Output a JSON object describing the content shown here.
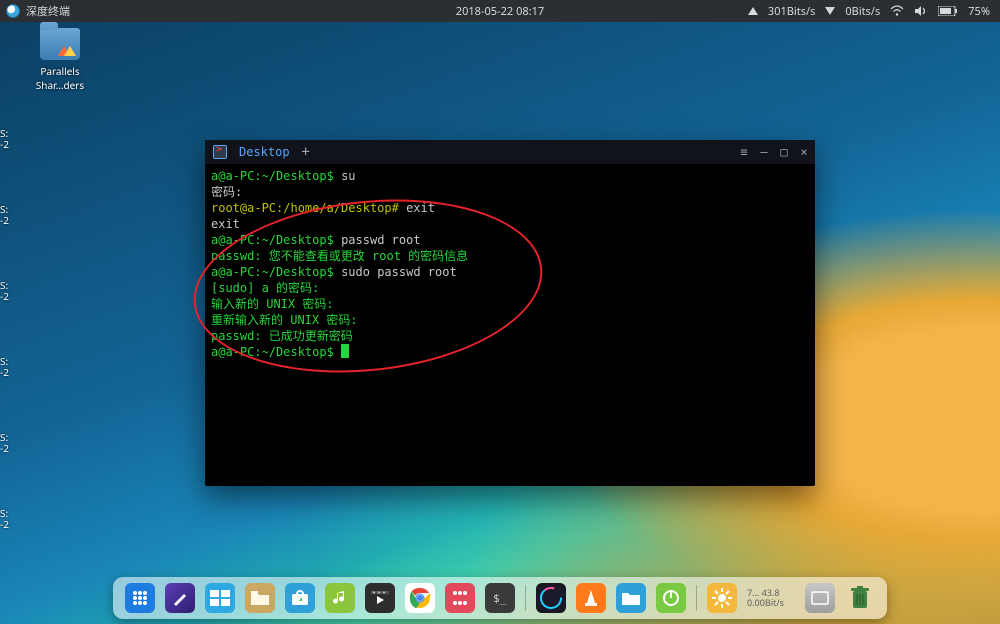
{
  "topbar": {
    "app_title": "深度终端",
    "datetime": "2018-05-22 08:17",
    "net_up": "301Bits/s",
    "net_down": "0Bits/s",
    "battery": "75%"
  },
  "desktop": {
    "icon1_line1": "Parallels",
    "icon1_line2": "Shar…ders"
  },
  "left_edge": {
    "a": "S:",
    "b": "-2",
    "c": "S:",
    "d": "-2",
    "e": "S:",
    "f": "-2",
    "g": "S:",
    "h": "-2",
    "i": "S:",
    "j": "-2",
    "k": "S:",
    "l": "-2"
  },
  "terminal": {
    "tab_label": "Desktop",
    "newtab": "+",
    "min": "–",
    "max": "□",
    "close": "×",
    "menu": "≡",
    "l1_prompt": "a@a-PC",
    "l1_path": ":~/Desktop$",
    "l1_cmd": " su",
    "l2": "密码:",
    "l3_prompt": "root@a-PC:/home/a/Desktop#",
    "l3_cmd": " exit",
    "l4": "exit",
    "l5_prompt": "a@a-PC",
    "l5_path": ":~/Desktop$",
    "l5_cmd": " passwd root",
    "l6": "passwd: 您不能查看或更改 root 的密码信息",
    "l7_prompt": "a@a-PC",
    "l7_path": ":~/Desktop$",
    "l7_cmd": " sudo passwd root",
    "l8": "[sudo] a 的密码:",
    "l9": "输入新的 UNIX 密码:",
    "l10": "重新输入新的 UNIX 密码:",
    "l11": "passwd: 已成功更新密码",
    "l12_prompt": "a@a-PC",
    "l12_path": ":~/Desktop$"
  },
  "dock": {
    "meta_line1": "7…  43.8",
    "meta_line2": "0.00Bit/s"
  }
}
